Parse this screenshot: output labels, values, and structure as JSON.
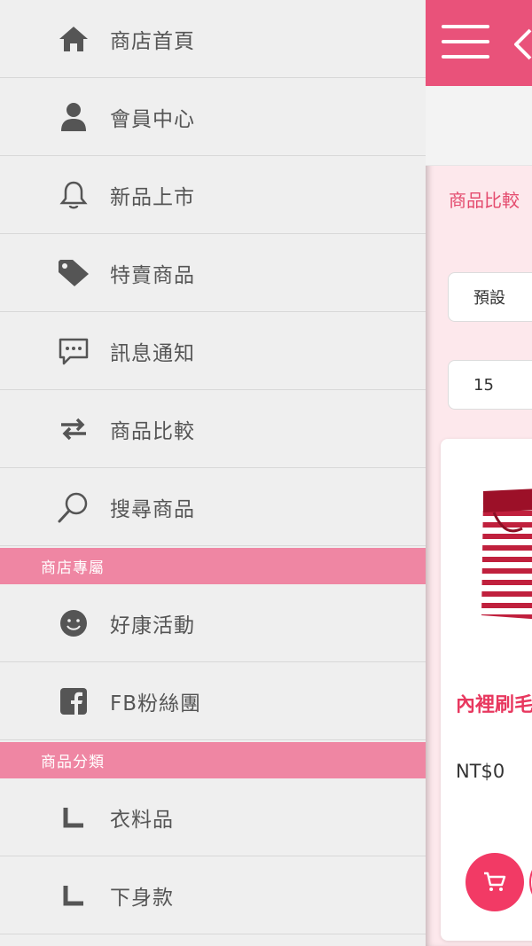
{
  "drawer": {
    "items": [
      {
        "label": "商店首頁",
        "icon": "home-icon"
      },
      {
        "label": "會員中心",
        "icon": "user-icon"
      },
      {
        "label": "新品上市",
        "icon": "bell-icon"
      },
      {
        "label": "特賣商品",
        "icon": "tag-icon"
      },
      {
        "label": "訊息通知",
        "icon": "chat-icon"
      },
      {
        "label": "商品比較",
        "icon": "compare-arrows-icon"
      },
      {
        "label": "搜尋商品",
        "icon": "search-icon"
      }
    ],
    "store_section": {
      "title": "商店專屬",
      "items": [
        {
          "label": "好康活動",
          "icon": "smile-icon"
        },
        {
          "label": "FB粉絲團",
          "icon": "facebook-icon"
        }
      ]
    },
    "category_section": {
      "title": "商品分類",
      "items": [
        {
          "label": "衣料品",
          "icon": "corner-icon"
        },
        {
          "label": "下身款",
          "icon": "corner-icon"
        }
      ]
    }
  },
  "main": {
    "breadcrumb": "商品比較",
    "sort_select": "預設",
    "per_page_select": "15",
    "product": {
      "name": "內裡刷毛",
      "price": "NT$0"
    }
  },
  "colors": {
    "brand": "#e9527a",
    "section": "#ef86a3",
    "accent": "#f23a65"
  }
}
